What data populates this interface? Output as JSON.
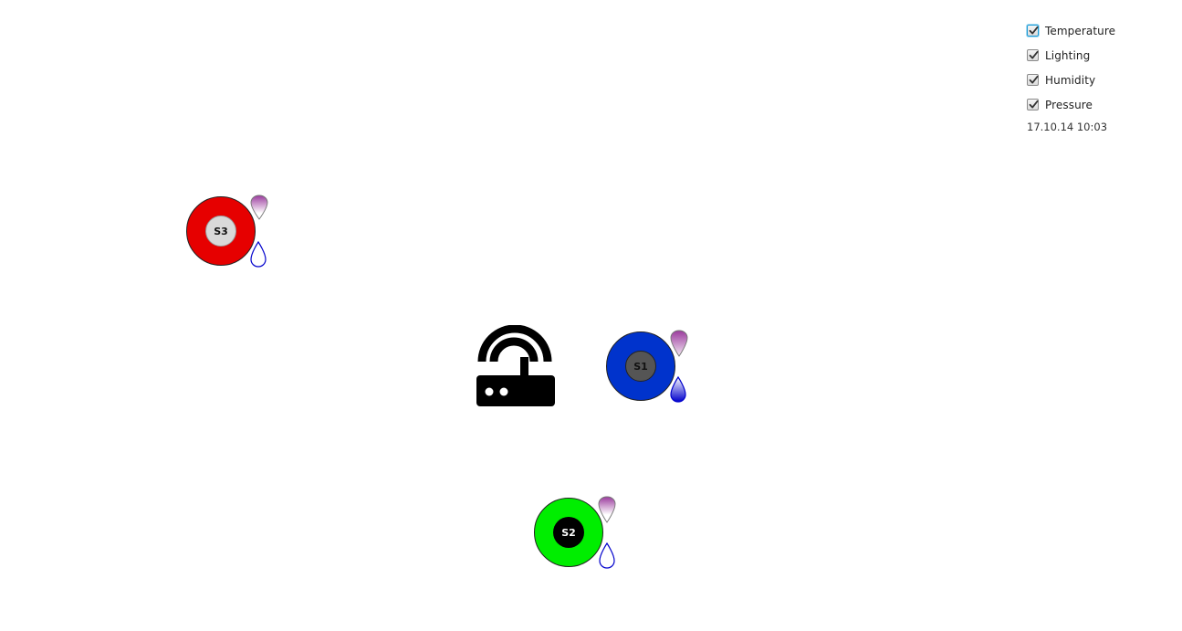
{
  "filters": {
    "items": [
      {
        "label": "Temperature",
        "checked": true,
        "focused": true
      },
      {
        "label": "Lighting",
        "checked": true,
        "focused": false
      },
      {
        "label": "Humidity",
        "checked": true,
        "focused": false
      },
      {
        "label": "Pressure",
        "checked": true,
        "focused": false
      }
    ],
    "timestamp": "17.10.14 10:03"
  },
  "sensors": [
    {
      "id": "S1",
      "label": "S1",
      "ring_color": "#0033cc",
      "core_color": "#555555",
      "text_color": "#111111"
    },
    {
      "id": "S2",
      "label": "S2",
      "ring_color": "#00ee00",
      "core_color": "#000000",
      "text_color": "#ffffff"
    },
    {
      "id": "S3",
      "label": "S3",
      "ring_color": "#e60000",
      "core_color": "#d9d9d9",
      "text_color": "#111111"
    }
  ],
  "hub": {
    "icon": "router-icon"
  },
  "colors": {
    "pin_gradient_top": "#9b3a9e",
    "pin_gradient_bottom": "#ffffff",
    "drop_stroke": "#0000cc",
    "drop_fill_bottom": "#0000cc"
  }
}
